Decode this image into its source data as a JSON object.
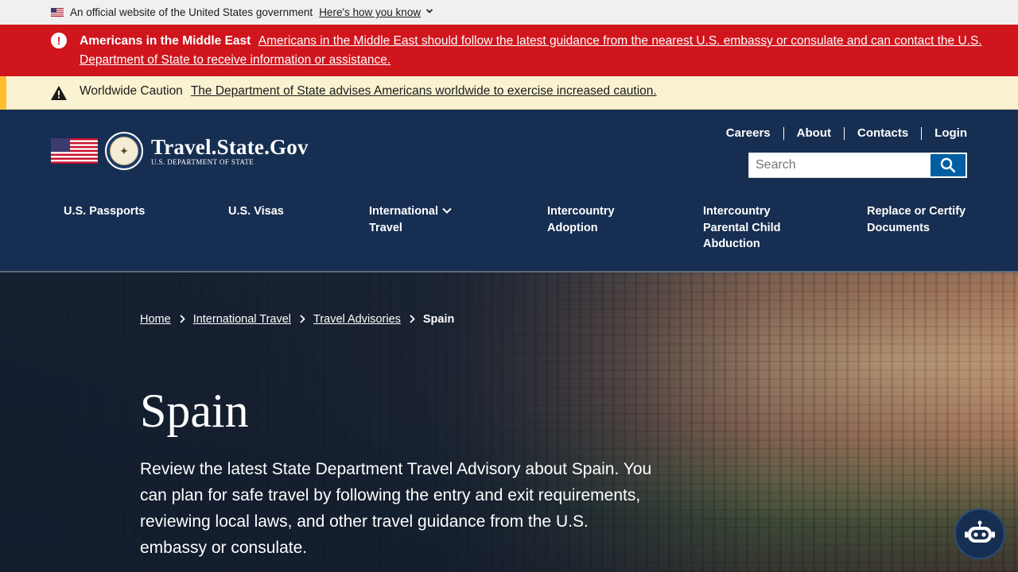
{
  "gov_banner": {
    "text": "An official website of the United States government",
    "how_know": "Here's how you know"
  },
  "alert": {
    "title": "Americans in the Middle East",
    "link": "Americans in the Middle East should follow the latest guidance from the nearest U.S. embassy or consulate and can contact the U.S. Department of State to receive information or assistance."
  },
  "caution": {
    "title": "Worldwide Caution",
    "link": "The Department of State advises Americans worldwide to exercise increased caution."
  },
  "header": {
    "site_name": "Travel.State.Gov",
    "site_sub": "U.S. Department of State",
    "utility_nav": [
      "Careers",
      "About",
      "Contacts",
      "Login"
    ],
    "search_placeholder": "Search"
  },
  "main_nav": [
    {
      "label": "U.S. Passports"
    },
    {
      "label": "U.S. Visas"
    },
    {
      "label": "International Travel"
    },
    {
      "label": "Intercountry Adoption"
    },
    {
      "label": "Intercountry Parental Child Abduction"
    },
    {
      "label": "Replace or Certify Documents"
    }
  ],
  "breadcrumb": [
    "Home",
    "International Travel",
    "Travel Advisories",
    "Spain"
  ],
  "hero": {
    "title": "Spain",
    "lead": "Review the latest State Department Travel Advisory about Spain. You can plan for safe travel by following the entry and exit requirements, reviewing local laws, and other travel guidance from the U.S. embassy or consulate."
  },
  "icons": {
    "alert": "exclamation-circle-icon",
    "caution": "warning-triangle-icon",
    "search": "search-icon",
    "chatbot": "robot-icon"
  },
  "colors": {
    "header_bg": "#162e51",
    "alert_red": "#d0151d",
    "caution_bg": "#faf3d1",
    "caution_border": "#ffbe2e",
    "search_button": "#005ea2"
  }
}
